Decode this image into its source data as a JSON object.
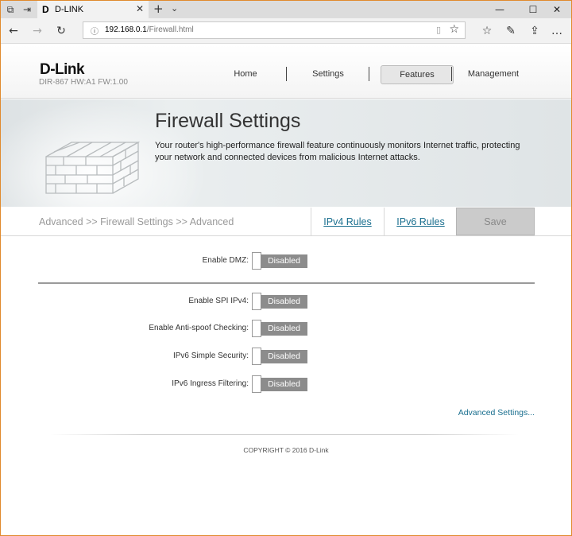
{
  "browser": {
    "tab_title": "D-LINK",
    "tab_favicon": "D",
    "address": {
      "host": "192.168.0.1",
      "path": "/Firewall.html"
    }
  },
  "header": {
    "logo": "D-Link",
    "model": "DIR-867 HW:A1 FW:1.00",
    "menu": [
      {
        "label": "Home",
        "active": false
      },
      {
        "label": "Settings",
        "active": false
      },
      {
        "label": "Features",
        "active": true
      },
      {
        "label": "Management",
        "active": false
      }
    ]
  },
  "banner": {
    "title": "Firewall Settings",
    "description": "Your router's high-performance firewall feature continuously monitors Internet traffic, protecting your network and connected devices from malicious Internet attacks."
  },
  "subbar": {
    "breadcrumb": "Advanced >> Firewall Settings >> Advanced",
    "ipv4_rules": "IPv4 Rules",
    "ipv6_rules": "IPv6 Rules",
    "save": "Save"
  },
  "settings": {
    "dmz": {
      "label": "Enable DMZ:",
      "state": "Disabled"
    },
    "spi": {
      "label": "Enable SPI IPv4:",
      "state": "Disabled"
    },
    "antispoof": {
      "label": "Enable Anti-spoof Checking:",
      "state": "Disabled"
    },
    "ipv6_security": {
      "label": "IPv6 Simple Security:",
      "state": "Disabled"
    },
    "ipv6_ingress": {
      "label": "IPv6 Ingress Filtering:",
      "state": "Disabled"
    }
  },
  "advanced_link": "Advanced Settings...",
  "footer": {
    "copyright": "COPYRIGHT © 2016 D-Link"
  },
  "colors": {
    "link": "#1a6f8f",
    "toggle_off": "#8c8c8c",
    "save_disabled": "#cbcbcb",
    "window_border": "#e08a2e"
  }
}
